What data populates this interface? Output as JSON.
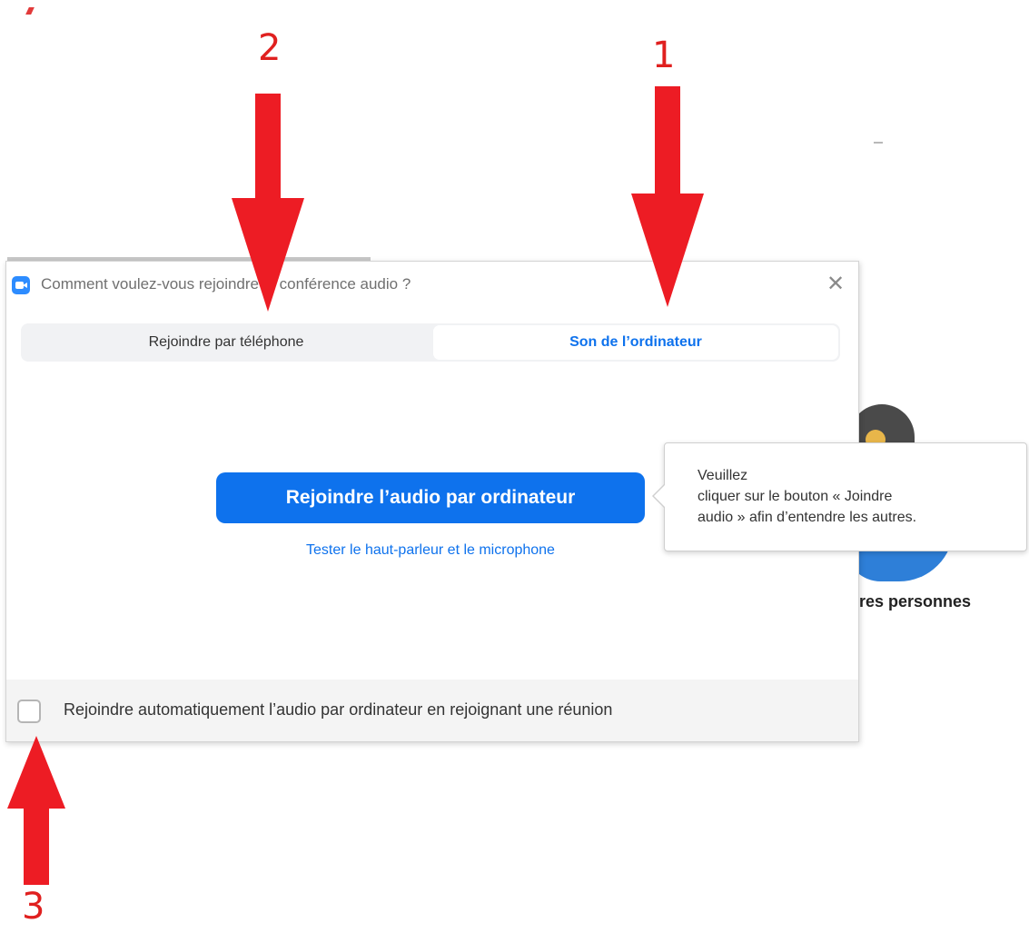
{
  "dialog": {
    "title": "Comment voulez-vous rejoindre la conférence audio ?",
    "close_icon": "close-icon",
    "app_icon": "zoom-camera-icon"
  },
  "tabs": [
    {
      "label": "Rejoindre par téléphone",
      "active": false
    },
    {
      "label": "Son de l’ordinateur",
      "active": true
    }
  ],
  "main": {
    "join_button_label": "Rejoindre l’audio par ordinateur",
    "test_link_label": "Tester le haut-parleur et le microphone"
  },
  "footer": {
    "checkbox_checked": false,
    "checkbox_label": "Rejoindre automatiquement l’audio par ordinateur en rejoignant une réunion"
  },
  "tooltip": {
    "line1": "Veuillez",
    "line2": "cliquer sur le bouton « Joindre",
    "line3": "audio » afin d’entendre les autres."
  },
  "background": {
    "label_fragment": "tres personnes"
  },
  "annotations": {
    "marker_1": "1",
    "marker_2": "2",
    "marker_3": "3",
    "color": "#ed1c24"
  },
  "colors": {
    "accent": "#0e72ed",
    "annotation_red": "#ed1c24"
  }
}
